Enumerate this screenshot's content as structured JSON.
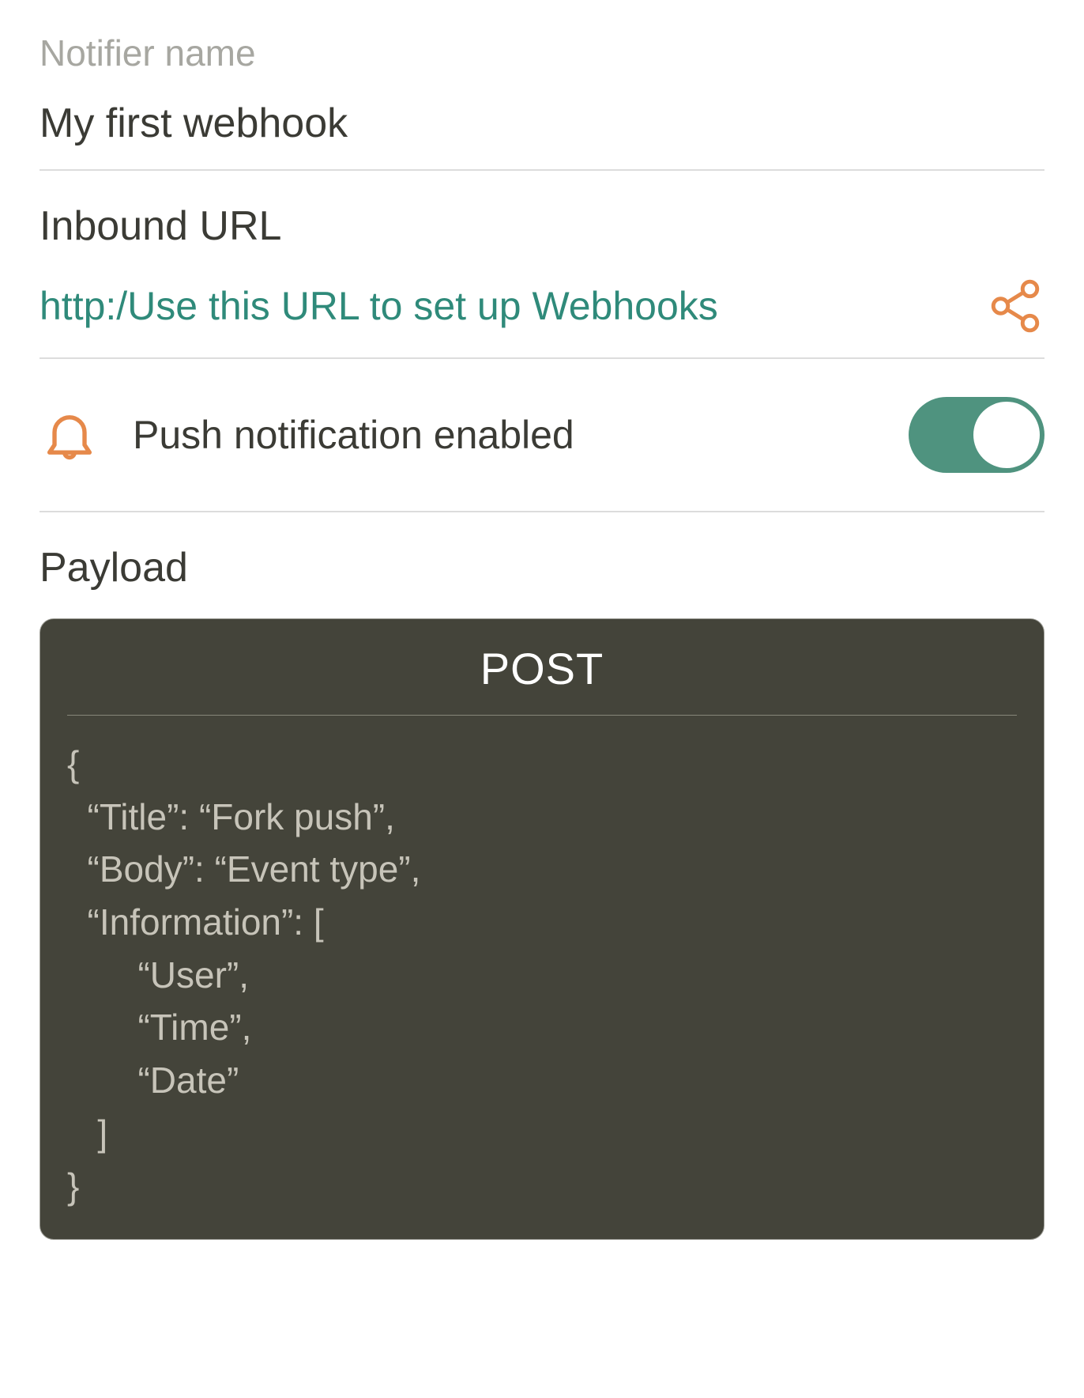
{
  "notifier": {
    "label": "Notifier name",
    "value": "My first webhook"
  },
  "inbound": {
    "heading": "Inbound URL",
    "url_text": "http:/Use this URL to set up Webhooks"
  },
  "push": {
    "label": "Push notification enabled",
    "enabled": true
  },
  "payload": {
    "heading": "Payload",
    "method": "POST",
    "body": "{\n  “Title”: “Fork push”,\n  “Body”: “Event type”,\n  “Information”: [\n       “User”,\n       “Time”,\n       “Date”\n   ]\n}"
  },
  "colors": {
    "accent_teal": "#2f8a7a",
    "accent_orange": "#e6894a",
    "toggle_bg": "#4f937f",
    "payload_bg": "#44443a"
  }
}
